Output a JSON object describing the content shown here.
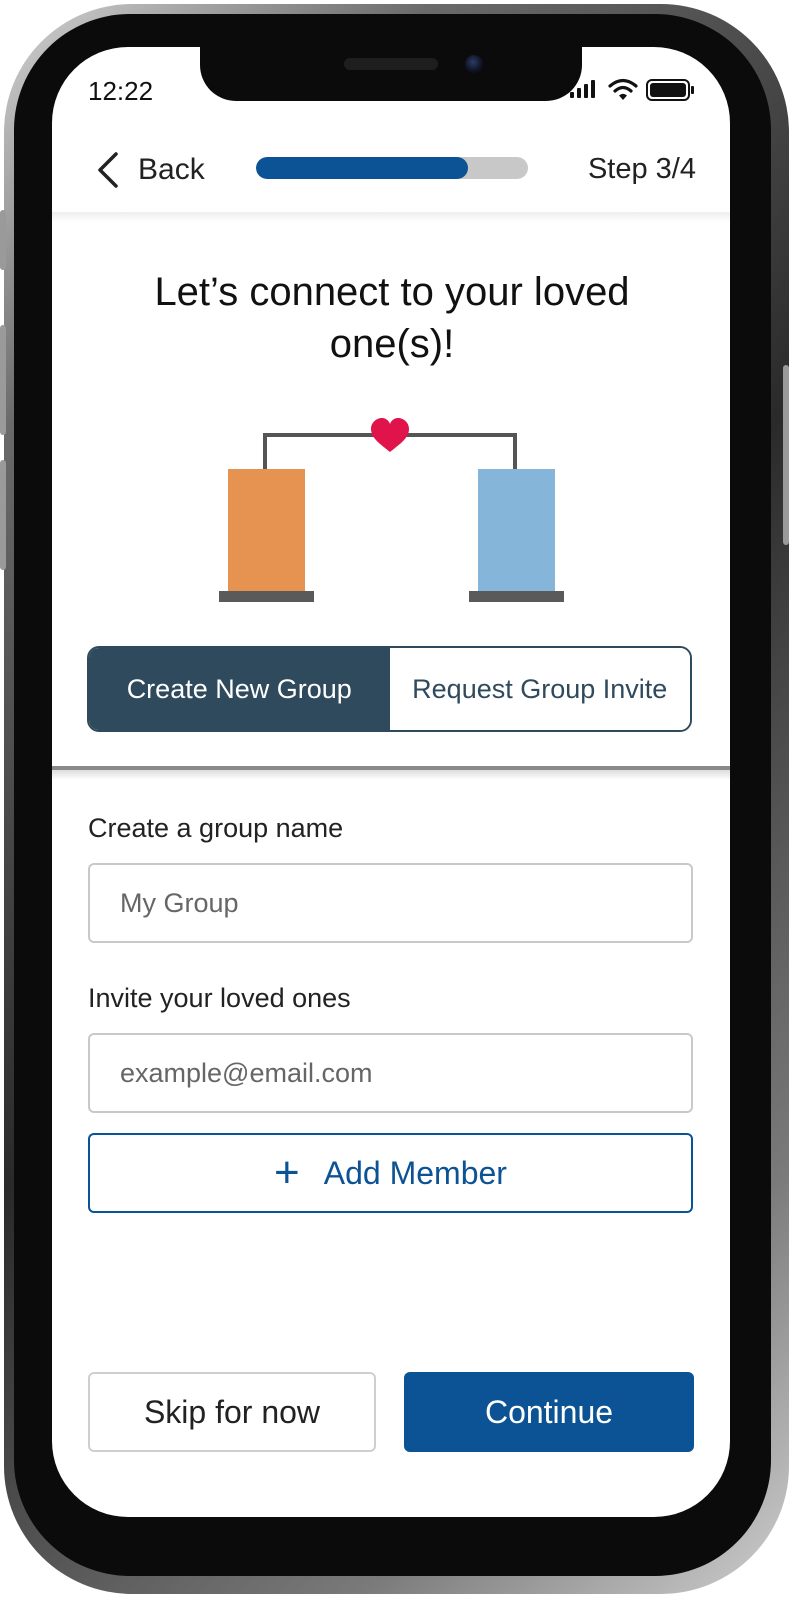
{
  "status_bar": {
    "time": "12:22",
    "icons": [
      "signal-icon",
      "wifi-icon",
      "battery-icon"
    ]
  },
  "header": {
    "back_label": "Back",
    "progress_value": 0.78,
    "step_label": "Step 3/4"
  },
  "title": "Let’s connect to your loved one(s)!",
  "illustration": {
    "left_color": "#e69352",
    "right_color": "#85b6da",
    "heart_color": "#e0134a"
  },
  "segment": {
    "options": [
      "Create New Group",
      "Request Group Invite"
    ],
    "selected": "Create New Group"
  },
  "form": {
    "group_name_label": "Create a group name",
    "group_name_placeholder": "My Group",
    "invite_label": "Invite your loved ones",
    "invite_placeholder": "example@email.com",
    "add_member_label": "Add Member"
  },
  "actions": {
    "skip_label": "Skip for now",
    "continue_label": "Continue"
  },
  "colors": {
    "primary": "#0b5394",
    "segment_dark": "#2f4a5c"
  }
}
